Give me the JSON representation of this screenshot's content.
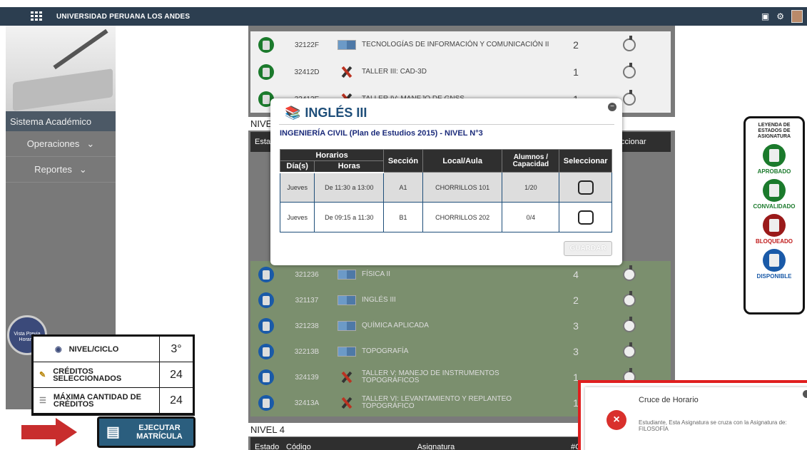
{
  "topbar": {
    "brand": "UNIVERSIDAD PERUANA LOS ANDES",
    "icons": [
      "grid-icon",
      "chat-icon",
      "gear-icon",
      "avatar"
    ]
  },
  "sidebar": {
    "title": "Sistema Académico",
    "items": [
      {
        "label": "Operaciones",
        "chevron": "⌄"
      },
      {
        "label": "Reportes",
        "chevron": "⌄"
      }
    ]
  },
  "top_rows": [
    {
      "code": "32122F",
      "name": "TECNOLOGÍAS DE INFORMACIÓN Y COMUNICACIÓN II",
      "credits": "2",
      "type": "book"
    },
    {
      "code": "32412D",
      "name": "TALLER III: CAD-3D",
      "credits": "1",
      "type": "tools"
    },
    {
      "code": "32412E",
      "name": "TALLER IV: MANEJO DE GNSS",
      "credits": "1",
      "type": "tools"
    }
  ],
  "nivel3": {
    "label": "NIVE",
    "estado": "Esta",
    "seleccionar": "Seleccionar"
  },
  "bottom_rows": [
    {
      "code": "321236",
      "name": "FÍSICA II",
      "credits": "4",
      "type": "book"
    },
    {
      "code": "321137",
      "name": "INGLÉS III",
      "credits": "2",
      "type": "book"
    },
    {
      "code": "321238",
      "name": "QUÍMICA APLICADA",
      "credits": "3",
      "type": "book"
    },
    {
      "code": "32213B",
      "name": "TOPOGRAFÍA",
      "credits": "3",
      "type": "book"
    },
    {
      "code": "324139",
      "name": "TALLER V: MANEJO DE INSTRUMENTOS TOPOGRÁFICOS",
      "credits": "1",
      "type": "tools"
    },
    {
      "code": "32413A",
      "name": "TALLER VI: LEVANTAMIENTO Y REPLANTEO TOPOGRÁFICO",
      "credits": "1",
      "type": "tools"
    }
  ],
  "nivel4": {
    "label": "NIVEL 4",
    "cols": [
      "Estado",
      "Código",
      "Asignatura",
      "#C"
    ]
  },
  "legend": {
    "title": "LEYENDA DE ESTADOS DE ASIGNATURA",
    "items": [
      {
        "label": "APROBADO",
        "color": "#1b7a2c",
        "text_color": "#1b7a2c"
      },
      {
        "label": "CONVALIDADO",
        "color": "#1b7a2c",
        "text_color": "#1b7a2c"
      },
      {
        "label": "BLOQUEADO",
        "color": "#9a1a1a",
        "text_color": "#c01b1b"
      },
      {
        "label": "DISPONIBLE",
        "color": "#1a5aa8",
        "text_color": "#1a5aa8"
      }
    ]
  },
  "previa": {
    "label": "Vista Previa Horario"
  },
  "stats": {
    "nivel_label": "NIVEL/CICLO",
    "nivel_value": "3°",
    "creditos_label": "CRÉDITOS SELECCIONADOS",
    "creditos_value": "24",
    "max_label": "MÁXIMA CANTIDAD DE CRÉDITOS",
    "max_value": "24"
  },
  "ejecutar": {
    "label": "EJECUTAR MATRÍCULA"
  },
  "modal": {
    "title": "INGLÉS III",
    "subtitle": "INGENIERÍA CIVIL (Plan de Estudios 2015) - NIVEL N°3",
    "headers": {
      "horarios": "Horarios",
      "dias": "Día(s)",
      "horas": "Horas",
      "seccion": "Sección",
      "local": "Local/Aula",
      "alumnos": "Alumnos / Capacidad",
      "seleccionar": "Seleccionar"
    },
    "rows": [
      {
        "dia": "Jueves",
        "horas": "De 11:30 a 13:00",
        "seccion": "A1",
        "local": "CHORRILLOS 101",
        "alumnos": "1/20"
      },
      {
        "dia": "Jueves",
        "horas": "De 09:15 a 11:30",
        "seccion": "B1",
        "local": "CHORRILLOS 202",
        "alumnos": "0/4"
      }
    ],
    "guardar": "GUARDAR"
  },
  "toast": {
    "title": "Cruce de Horario",
    "message": "Estudiante, Esta Asignatura se cruza con la Asignatura de: FILOSOFÍA",
    "icon": "×"
  }
}
